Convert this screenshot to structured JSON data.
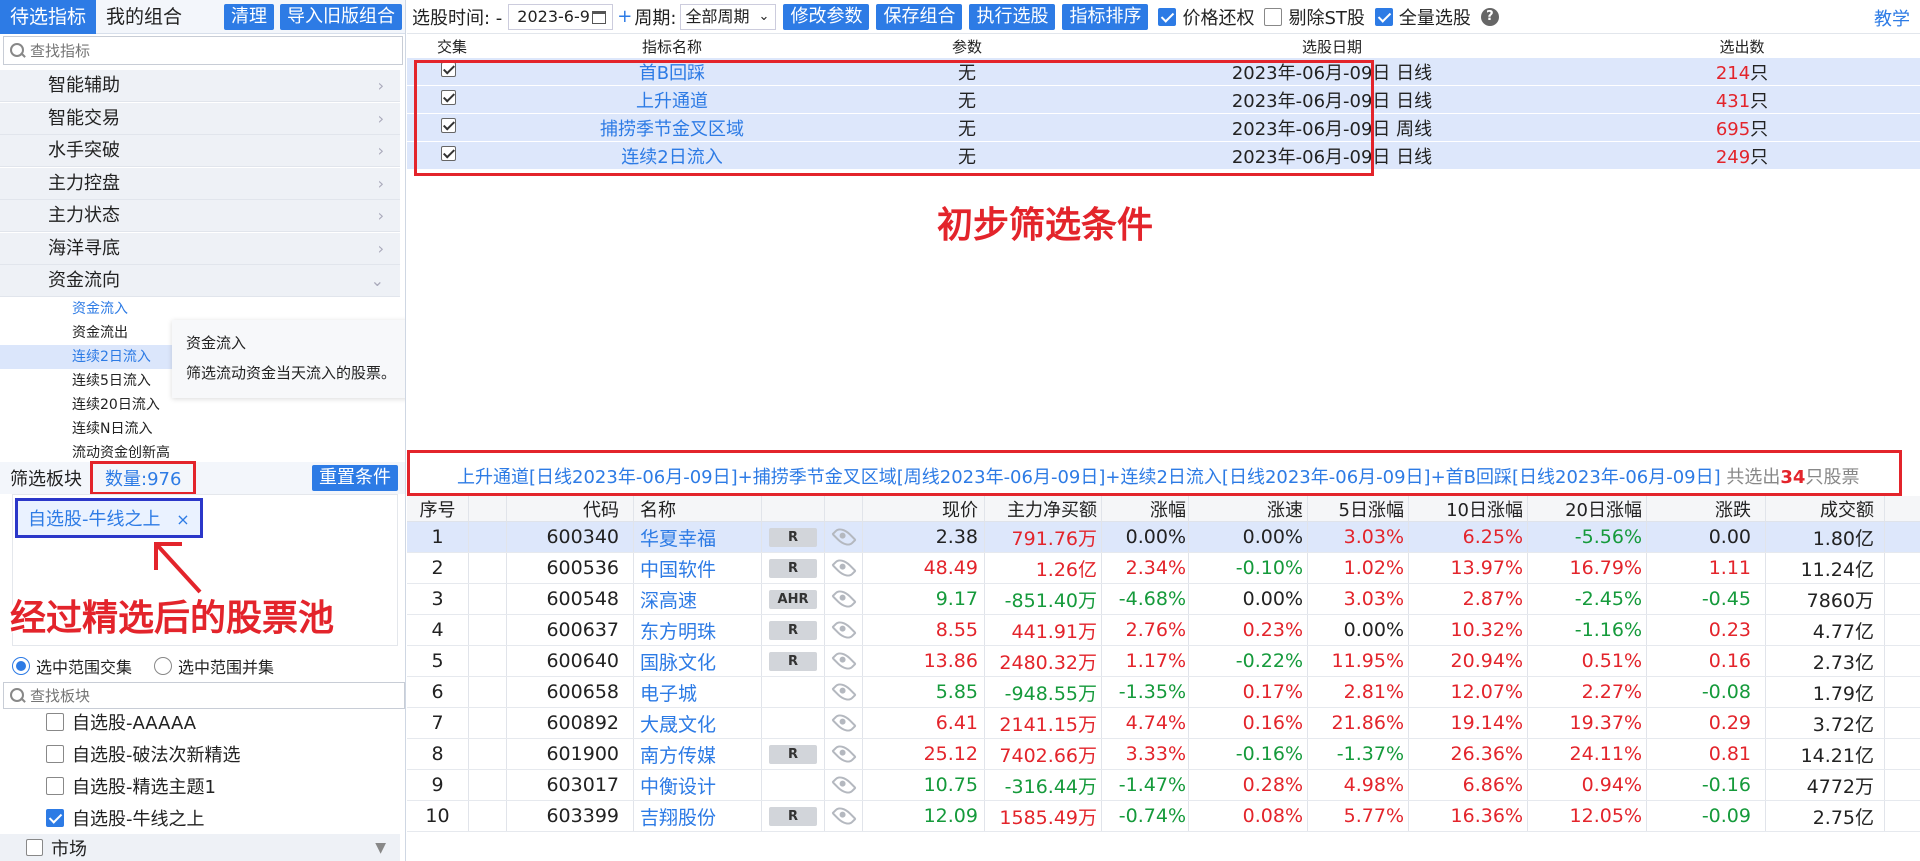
{
  "left": {
    "tabs": [
      "待选指标",
      "我的组合"
    ],
    "btn_clear": "清理",
    "btn_import": "导入旧版组合",
    "search_placeholder": "查找指标",
    "categories": [
      "智能辅助",
      "智能交易",
      "水手突破",
      "主力控盘",
      "主力状态",
      "海洋寻底",
      "资金流向"
    ],
    "subitems": [
      "资金流入",
      "资金流出",
      "连续2日流入",
      "连续5日流入",
      "连续20日流入",
      "连续N日流入",
      "流动资金创新高"
    ],
    "tooltip": {
      "title": "资金流入",
      "desc": "筛选流动资金当天流入的股票。"
    },
    "filter_label": "筛选板块",
    "count_label": "数量:976",
    "btn_reset": "重置条件",
    "pool_tag": "自选股-牛线之上",
    "pool_tag_close": "×",
    "annotation": "经过精选后的股票池",
    "radio1": "选中范围交集",
    "radio2": "选中范围并集",
    "board_search_placeholder": "查找板块",
    "boards": [
      {
        "label": "自选股-AAAAA",
        "checked": false
      },
      {
        "label": "自选股-破法次新精选",
        "checked": false
      },
      {
        "label": "自选股-精选主题1",
        "checked": false
      },
      {
        "label": "自选股-牛线之上",
        "checked": true
      }
    ],
    "market": "市场"
  },
  "topbar": {
    "time_label": "选股时间: -",
    "date": "2023-6-9",
    "plus": "+",
    "period_label": "周期:",
    "period": "全部周期",
    "buttons": [
      "修改参数",
      "保存组合",
      "执行选股",
      "指标排序"
    ],
    "checks": [
      {
        "label": "价格还权",
        "checked": true
      },
      {
        "label": "剔除ST股",
        "checked": false
      },
      {
        "label": "全量选股",
        "checked": true
      }
    ],
    "help": "?",
    "teach": "教学"
  },
  "conditions": {
    "headers": [
      "交集",
      "指标名称",
      "参数",
      "选股日期",
      "选出数"
    ],
    "unit": "只",
    "rows": [
      {
        "name": "首B回踩",
        "param": "无",
        "date": "2023年-06月-09日 日线",
        "count": "214"
      },
      {
        "name": "上升通道",
        "param": "无",
        "date": "2023年-06月-09日 日线",
        "count": "431"
      },
      {
        "name": "捕捞季节金叉区域",
        "param": "无",
        "date": "2023年-06月-09日 周线",
        "count": "695"
      },
      {
        "name": "连续2日流入",
        "param": "无",
        "date": "2023年-06月-09日 日线",
        "count": "249"
      }
    ],
    "annotation": "初步筛选条件"
  },
  "summary": {
    "text": "上升通道[日线2023年-06月-09日]+捕捞季节金叉区域[周线2023年-06月-09日]+连续2日流入[日线2023年-06月-09日]+首B回踩[日线2023年-06月-09日]",
    "prefix": "共选出",
    "count": "34",
    "suffix": "只股票"
  },
  "results": {
    "headers": [
      "序号",
      "",
      "代码",
      "名称",
      "",
      "",
      "现价",
      "主力净买额",
      "涨幅",
      "涨速",
      "5日涨幅",
      "10日涨幅",
      "20日涨幅",
      "涨跌",
      "成交额"
    ],
    "rows": [
      {
        "no": "1",
        "code": "600340",
        "name": "华夏幸福",
        "badge": "R",
        "price": "2.38",
        "net": "791.76万",
        "chg": "0.00%",
        "speed": "0.00%",
        "d5": "3.03%",
        "d10": "6.25%",
        "d20": "-5.56%",
        "diff": "0.00",
        "amount": "1.80亿"
      },
      {
        "no": "2",
        "code": "600536",
        "name": "中国软件",
        "badge": "R",
        "price": "48.49",
        "net": "1.26亿",
        "chg": "2.34%",
        "speed": "-0.10%",
        "d5": "1.02%",
        "d10": "13.97%",
        "d20": "16.79%",
        "diff": "1.11",
        "amount": "11.24亿"
      },
      {
        "no": "3",
        "code": "600548",
        "name": "深高速",
        "badge": "AHR",
        "price": "9.17",
        "net": "-851.40万",
        "chg": "-4.68%",
        "speed": "0.00%",
        "d5": "3.03%",
        "d10": "2.87%",
        "d20": "-2.45%",
        "diff": "-0.45",
        "amount": "7860万"
      },
      {
        "no": "4",
        "code": "600637",
        "name": "东方明珠",
        "badge": "R",
        "price": "8.55",
        "net": "441.91万",
        "chg": "2.76%",
        "speed": "0.23%",
        "d5": "0.00%",
        "d10": "10.32%",
        "d20": "-1.16%",
        "diff": "0.23",
        "amount": "4.77亿"
      },
      {
        "no": "5",
        "code": "600640",
        "name": "国脉文化",
        "badge": "R",
        "price": "13.86",
        "net": "2480.32万",
        "chg": "1.17%",
        "speed": "-0.22%",
        "d5": "11.95%",
        "d10": "20.94%",
        "d20": "0.51%",
        "diff": "0.16",
        "amount": "2.73亿"
      },
      {
        "no": "6",
        "code": "600658",
        "name": "电子城",
        "badge": "",
        "price": "5.85",
        "net": "-948.55万",
        "chg": "-1.35%",
        "speed": "0.17%",
        "d5": "2.81%",
        "d10": "12.07%",
        "d20": "2.27%",
        "diff": "-0.08",
        "amount": "1.79亿"
      },
      {
        "no": "7",
        "code": "600892",
        "name": "大晟文化",
        "badge": "",
        "price": "6.41",
        "net": "2141.15万",
        "chg": "4.74%",
        "speed": "0.16%",
        "d5": "21.86%",
        "d10": "19.14%",
        "d20": "19.37%",
        "diff": "0.29",
        "amount": "3.72亿"
      },
      {
        "no": "8",
        "code": "601900",
        "name": "南方传媒",
        "badge": "R",
        "price": "25.12",
        "net": "7402.66万",
        "chg": "3.33%",
        "speed": "-0.16%",
        "d5": "-1.37%",
        "d10": "26.36%",
        "d20": "24.11%",
        "diff": "0.81",
        "amount": "14.21亿"
      },
      {
        "no": "9",
        "code": "603017",
        "name": "中衡设计",
        "badge": "",
        "price": "10.75",
        "net": "-316.44万",
        "chg": "-1.47%",
        "speed": "0.28%",
        "d5": "4.98%",
        "d10": "6.86%",
        "d20": "0.94%",
        "diff": "-0.16",
        "amount": "4772万"
      },
      {
        "no": "10",
        "code": "603399",
        "name": "吉翔股份",
        "badge": "R",
        "price": "12.09",
        "net": "1585.49万",
        "chg": "-0.74%",
        "speed": "0.08%",
        "d5": "5.77%",
        "d10": "16.36%",
        "d20": "12.05%",
        "diff": "-0.09",
        "amount": "2.75亿"
      }
    ]
  },
  "colors": {
    "accent": "#2d7be5",
    "up": "#e3242b",
    "down": "#159a3b",
    "highlight": "#e3242b",
    "tag_border": "#2b37c9"
  }
}
